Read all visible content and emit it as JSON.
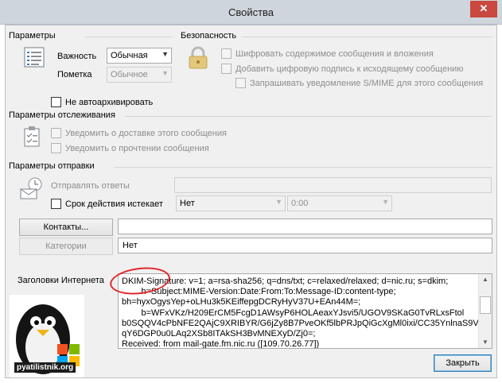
{
  "window": {
    "title": "Свойства",
    "close_glyph": "✕"
  },
  "params": {
    "title": "Параметры",
    "importance_label": "Важность",
    "importance_value": "Обычная",
    "sensitivity_label": "Пометка",
    "sensitivity_value": "Обычное",
    "no_autoarchive_label": "Не автоархивировать",
    "icon": "properties-list-icon"
  },
  "security": {
    "title": "Безопасность",
    "icon": "padlock-icon",
    "options": [
      "Шифровать содержимое сообщения и вложения",
      "Добавить цифровую подпись к исходящему сообщению",
      "Запрашивать уведомление S/MIME для этого сообщения"
    ]
  },
  "tracking": {
    "title": "Параметры отслеживания",
    "icon": "tracking-clipboard-icon",
    "options": [
      "Уведомить о доставке этого сообщения",
      "Уведомить о прочтении сообщения"
    ]
  },
  "delivery": {
    "title": "Параметры отправки",
    "icon": "delivery-icon",
    "reply_to_label": "Отправлять ответы",
    "expires_label": "Срок действия истекает",
    "expires_date": "Нет",
    "expires_time": "0:00"
  },
  "contacts": {
    "button": "Контакты...",
    "value": ""
  },
  "categories": {
    "button": "Категории",
    "value": "Нет"
  },
  "headers": {
    "label": "Заголовки Интернета",
    "lines": [
      "DKIM-Signature: v=1; a=rsa-sha256; q=dns/txt; c=relaxed/relaxed; d=nic.ru; s=dkim;",
      "        h=Subject:MIME-Version:Date:From:To:Message-ID:content-type;",
      "bh=hyxOgysYep+oLHu3k5KEiffepgDCRyHyV37U+EAn44M=;",
      "        b=WFxVKz/H209ErCM5FcgD1AWsyP6HOLAeaxYJsvi5/UGOV9SKaG0TvRLxsFtol",
      "b0SQQV4cPbNFE2QAjC9XRIBYR/G6jZy8B7PveOKf5lbPRJpQiGcXgMl0ixi/CC35YnlnaS9Vru",
      "qY6DGP0u0LAq2XSb8ITAkSH3BvMNEXyD/Zj0=;",
      "Received: from mail-gate.fm.nic.ru ([109.70.26.77])"
    ]
  },
  "logo": {
    "text": "pyatilistnik.org"
  },
  "close_button": "Закрыть"
}
